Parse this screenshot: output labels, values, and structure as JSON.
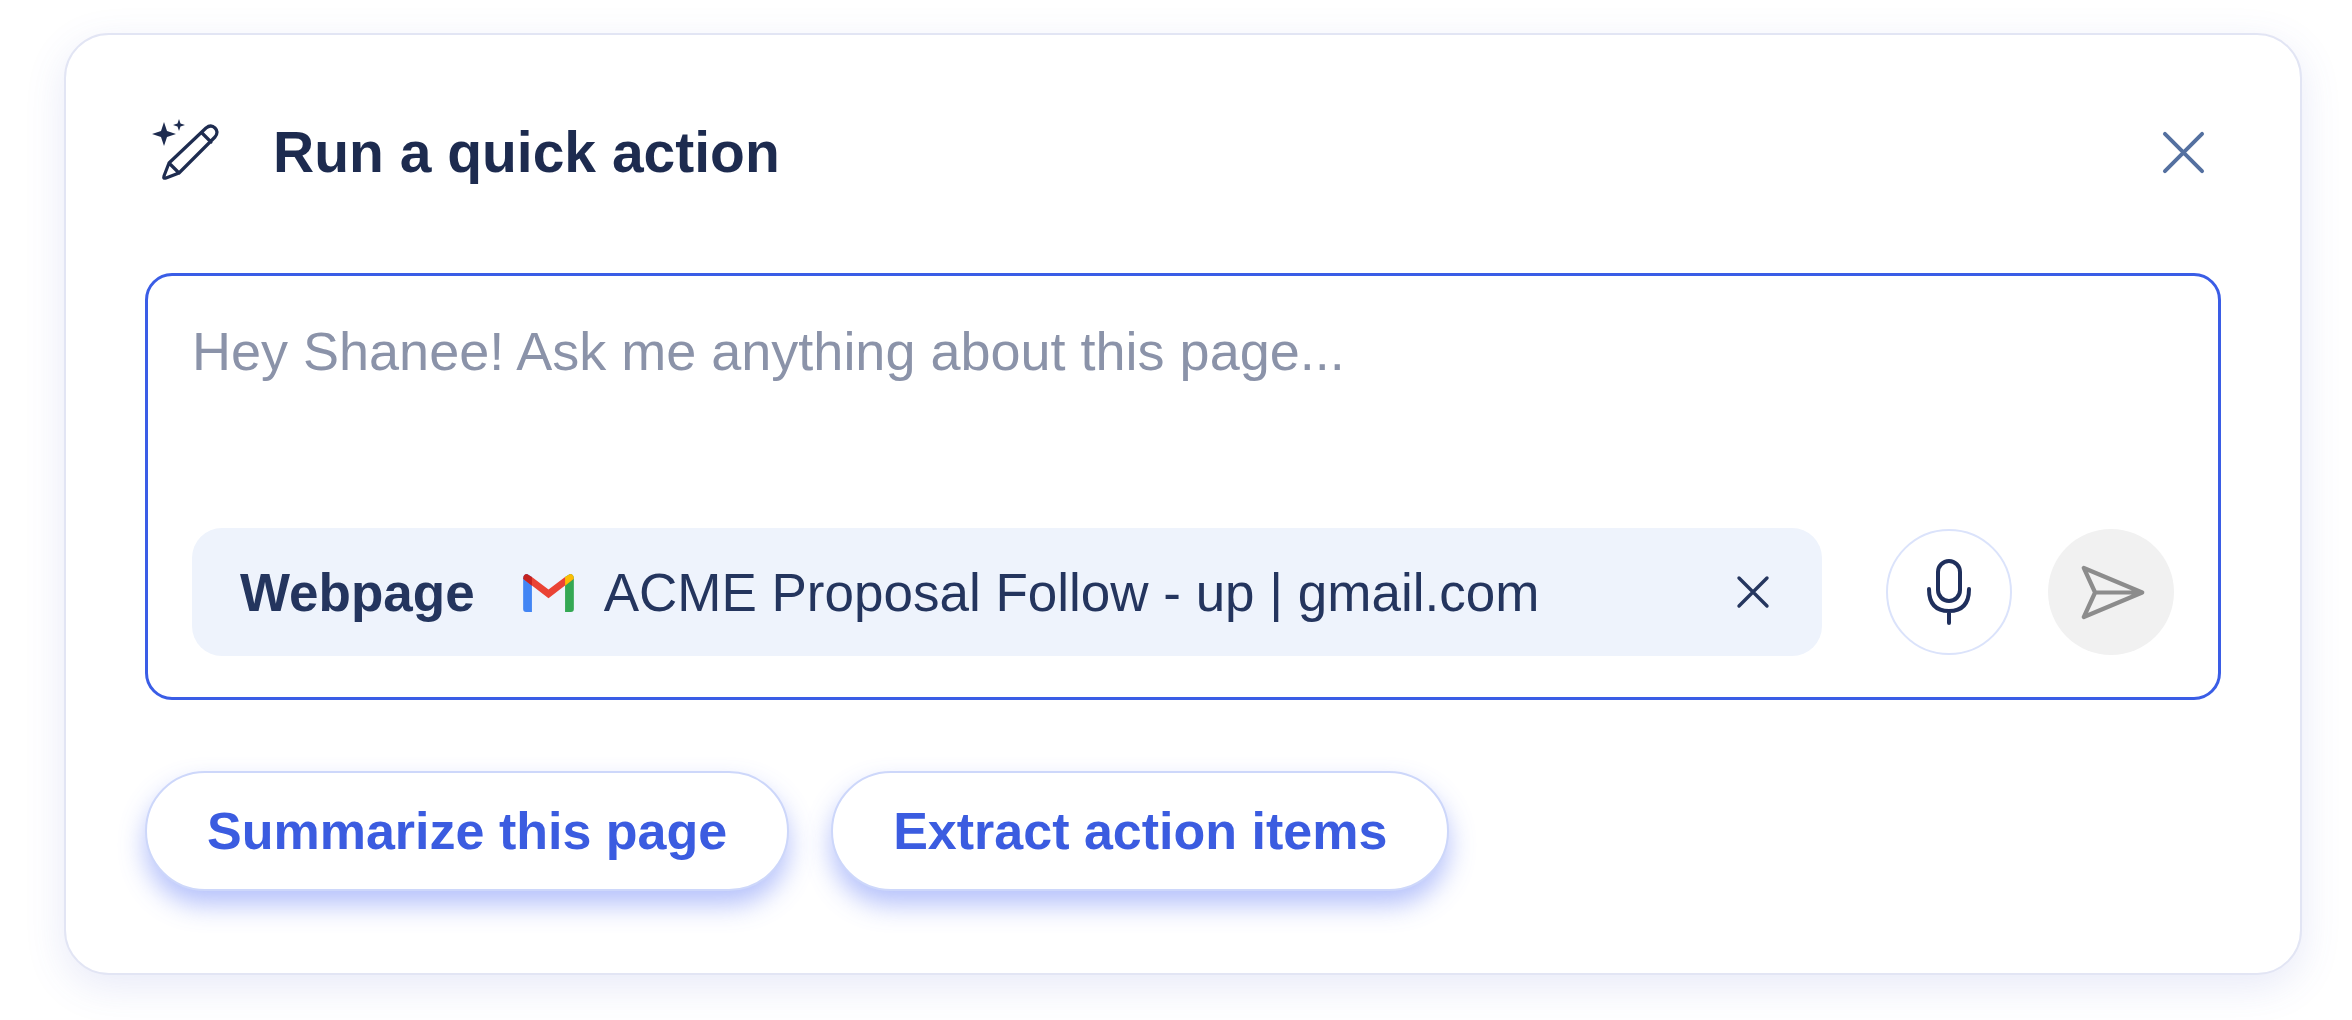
{
  "dialog": {
    "title": "Run a quick action"
  },
  "prompt": {
    "placeholder": "Hey Shanee! Ask me anything about this page..."
  },
  "context_chip": {
    "label": "Webpage",
    "page_title": "ACME Proposal Follow - up | gmail.com"
  },
  "send_button": {
    "disabled": true
  },
  "quick_actions": [
    "Summarize this page",
    "Extract action items"
  ]
}
